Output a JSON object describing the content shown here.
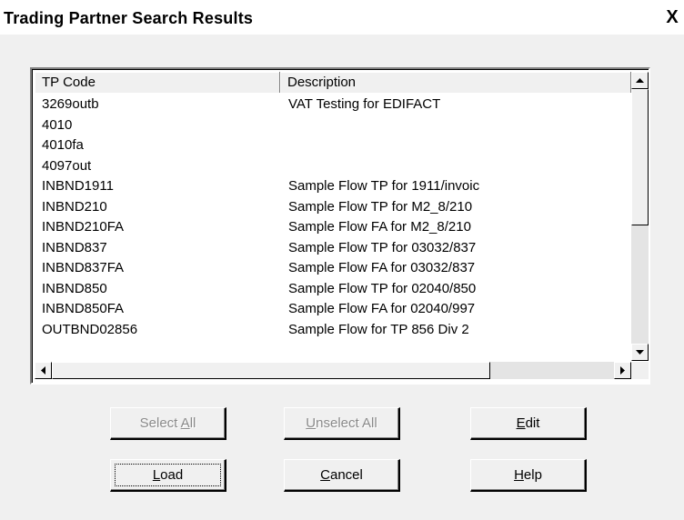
{
  "window": {
    "title": "Trading Partner Search Results",
    "close_glyph": "X"
  },
  "list": {
    "columns": [
      "TP Code",
      "Description"
    ],
    "rows": [
      {
        "code": "3269outb",
        "description": "VAT Testing for EDIFACT"
      },
      {
        "code": "4010",
        "description": ""
      },
      {
        "code": "4010fa",
        "description": ""
      },
      {
        "code": "4097out",
        "description": ""
      },
      {
        "code": "INBND1911",
        "description": "Sample Flow TP for 1911/invoic"
      },
      {
        "code": "INBND210",
        "description": "Sample Flow TP for M2_8/210"
      },
      {
        "code": "INBND210FA",
        "description": "Sample Flow FA for M2_8/210"
      },
      {
        "code": "INBND837",
        "description": "Sample Flow TP for 03032/837"
      },
      {
        "code": "INBND837FA",
        "description": "Sample Flow FA for 03032/837"
      },
      {
        "code": "INBND850",
        "description": "Sample Flow TP for 02040/850"
      },
      {
        "code": "INBND850FA",
        "description": "Sample Flow FA for 02040/997"
      },
      {
        "code": "OUTBND02856",
        "description": "Sample Flow for TP 856 Div 2"
      }
    ]
  },
  "buttons": {
    "select_all": {
      "pre": "Select ",
      "key": "A",
      "post": "ll",
      "enabled": false
    },
    "unselect_all": {
      "pre": "",
      "key": "U",
      "post": "nselect All",
      "enabled": false
    },
    "edit": {
      "pre": "",
      "key": "E",
      "post": "dit",
      "enabled": true
    },
    "load": {
      "pre": "",
      "key": "L",
      "post": "oad",
      "enabled": true,
      "default": true
    },
    "cancel": {
      "pre": "",
      "key": "C",
      "post": "ancel",
      "enabled": true
    },
    "help": {
      "pre": "",
      "key": "H",
      "post": "elp",
      "enabled": true
    }
  },
  "icons": {
    "scroll_up": "up-arrow-icon",
    "scroll_down": "down-arrow-icon",
    "scroll_left": "left-arrow-icon",
    "scroll_right": "right-arrow-icon"
  }
}
